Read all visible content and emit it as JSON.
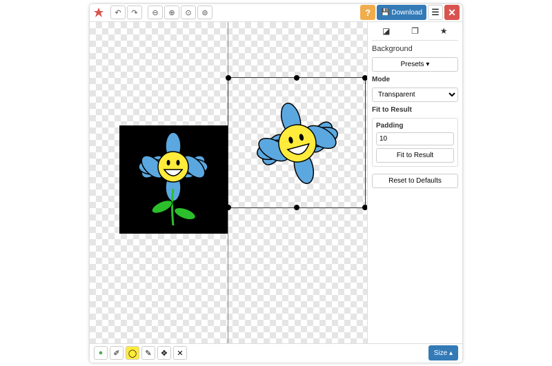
{
  "topbar": {
    "download_label": "Download"
  },
  "sidebar": {
    "title": "Background",
    "presets_label": "Presets ▾",
    "mode_label": "Mode",
    "mode_value": "Transparent",
    "fit_title": "Fit to Result",
    "padding_label": "Padding",
    "padding_value": "10",
    "fit_button": "Fit to Result",
    "reset_label": "Reset to Defaults"
  },
  "bottombar": {
    "size_label": "Size ▴"
  }
}
